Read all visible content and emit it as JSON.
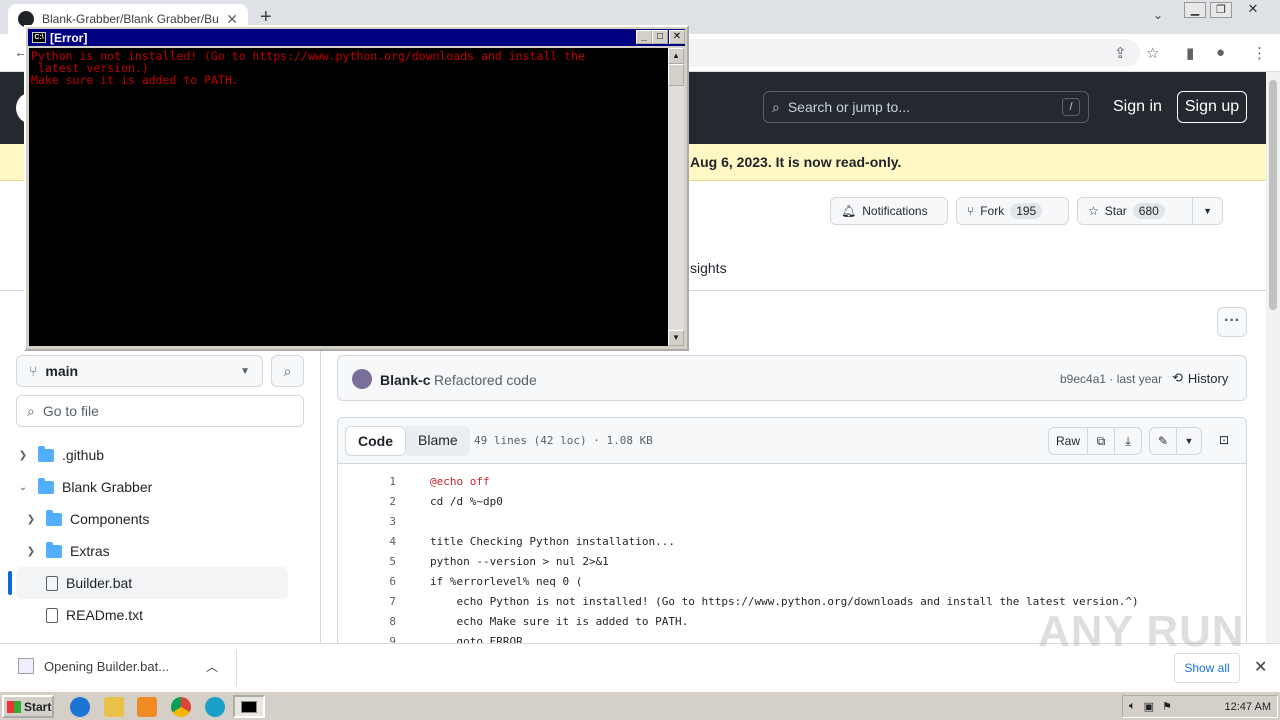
{
  "browser": {
    "tab_title": "Blank-Grabber/Blank Grabber/Builder.bat",
    "tab_close": "✕",
    "new_tab": "+",
    "tab_search": "⌄"
  },
  "github": {
    "search_placeholder": "Search or jump to...",
    "search_shortcut": "/",
    "sign_in": "Sign in",
    "sign_up": "Sign up",
    "archive_banner": "Aug 6, 2023. It is now read-only.",
    "notifications_label": "Notifications",
    "fork_label": "Fork",
    "fork_count": "195",
    "star_label": "Star",
    "star_count": "680",
    "nav_insights": "sights",
    "more_options": "···"
  },
  "sidebar": {
    "branch": "main",
    "goto_placeholder": "Go to file",
    "items": [
      {
        "label": ".github",
        "type": "folder",
        "expanded": false
      },
      {
        "label": "Blank Grabber",
        "type": "folder",
        "expanded": true
      },
      {
        "label": "Components",
        "type": "folder",
        "expanded": false
      },
      {
        "label": "Extras",
        "type": "folder",
        "expanded": false
      },
      {
        "label": "Builder.bat",
        "type": "file",
        "selected": true
      },
      {
        "label": "READme.txt",
        "type": "file"
      }
    ]
  },
  "commit": {
    "author": "Blank-c",
    "message": "Refactored code",
    "hash_time": "b9ec4a1 · last year",
    "history": "History"
  },
  "code": {
    "tab_code": "Code",
    "tab_blame": "Blame",
    "meta": "49 lines (42 loc) · 1.08 KB",
    "raw": "Raw",
    "lines": [
      {
        "n": "1",
        "text": "@echo off"
      },
      {
        "n": "2",
        "text": "cd /d %~dp0"
      },
      {
        "n": "3",
        "text": ""
      },
      {
        "n": "4",
        "text": "title Checking Python installation..."
      },
      {
        "n": "5",
        "text": "python --version > nul 2>&1"
      },
      {
        "n": "6",
        "text": "if %errorlevel% neq 0 ("
      },
      {
        "n": "7",
        "text": "    echo Python is not installed! (Go to https://www.python.org/downloads and install the latest version.^)"
      },
      {
        "n": "8",
        "text": "    echo Make sure it is added to PATH."
      },
      {
        "n": "9",
        "text": "    goto ERROR"
      }
    ]
  },
  "downloads": {
    "item": "Opening Builder.bat...",
    "show_all": "Show all",
    "close": "✕"
  },
  "watermark": "ANY RUN",
  "taskbar": {
    "start": "Start",
    "clock": "12:47 AM"
  },
  "console": {
    "title": "[Error]",
    "icon_text": "C:\\",
    "output": "Python is not installed! (Go to https://www.python.org/downloads and install the\n latest version.)\nMake sure it is added to PATH."
  },
  "colors": {
    "gh_header": "#24292f",
    "banner": "#fff8c5",
    "console_text": "#c00000",
    "console_title": "#000080"
  }
}
